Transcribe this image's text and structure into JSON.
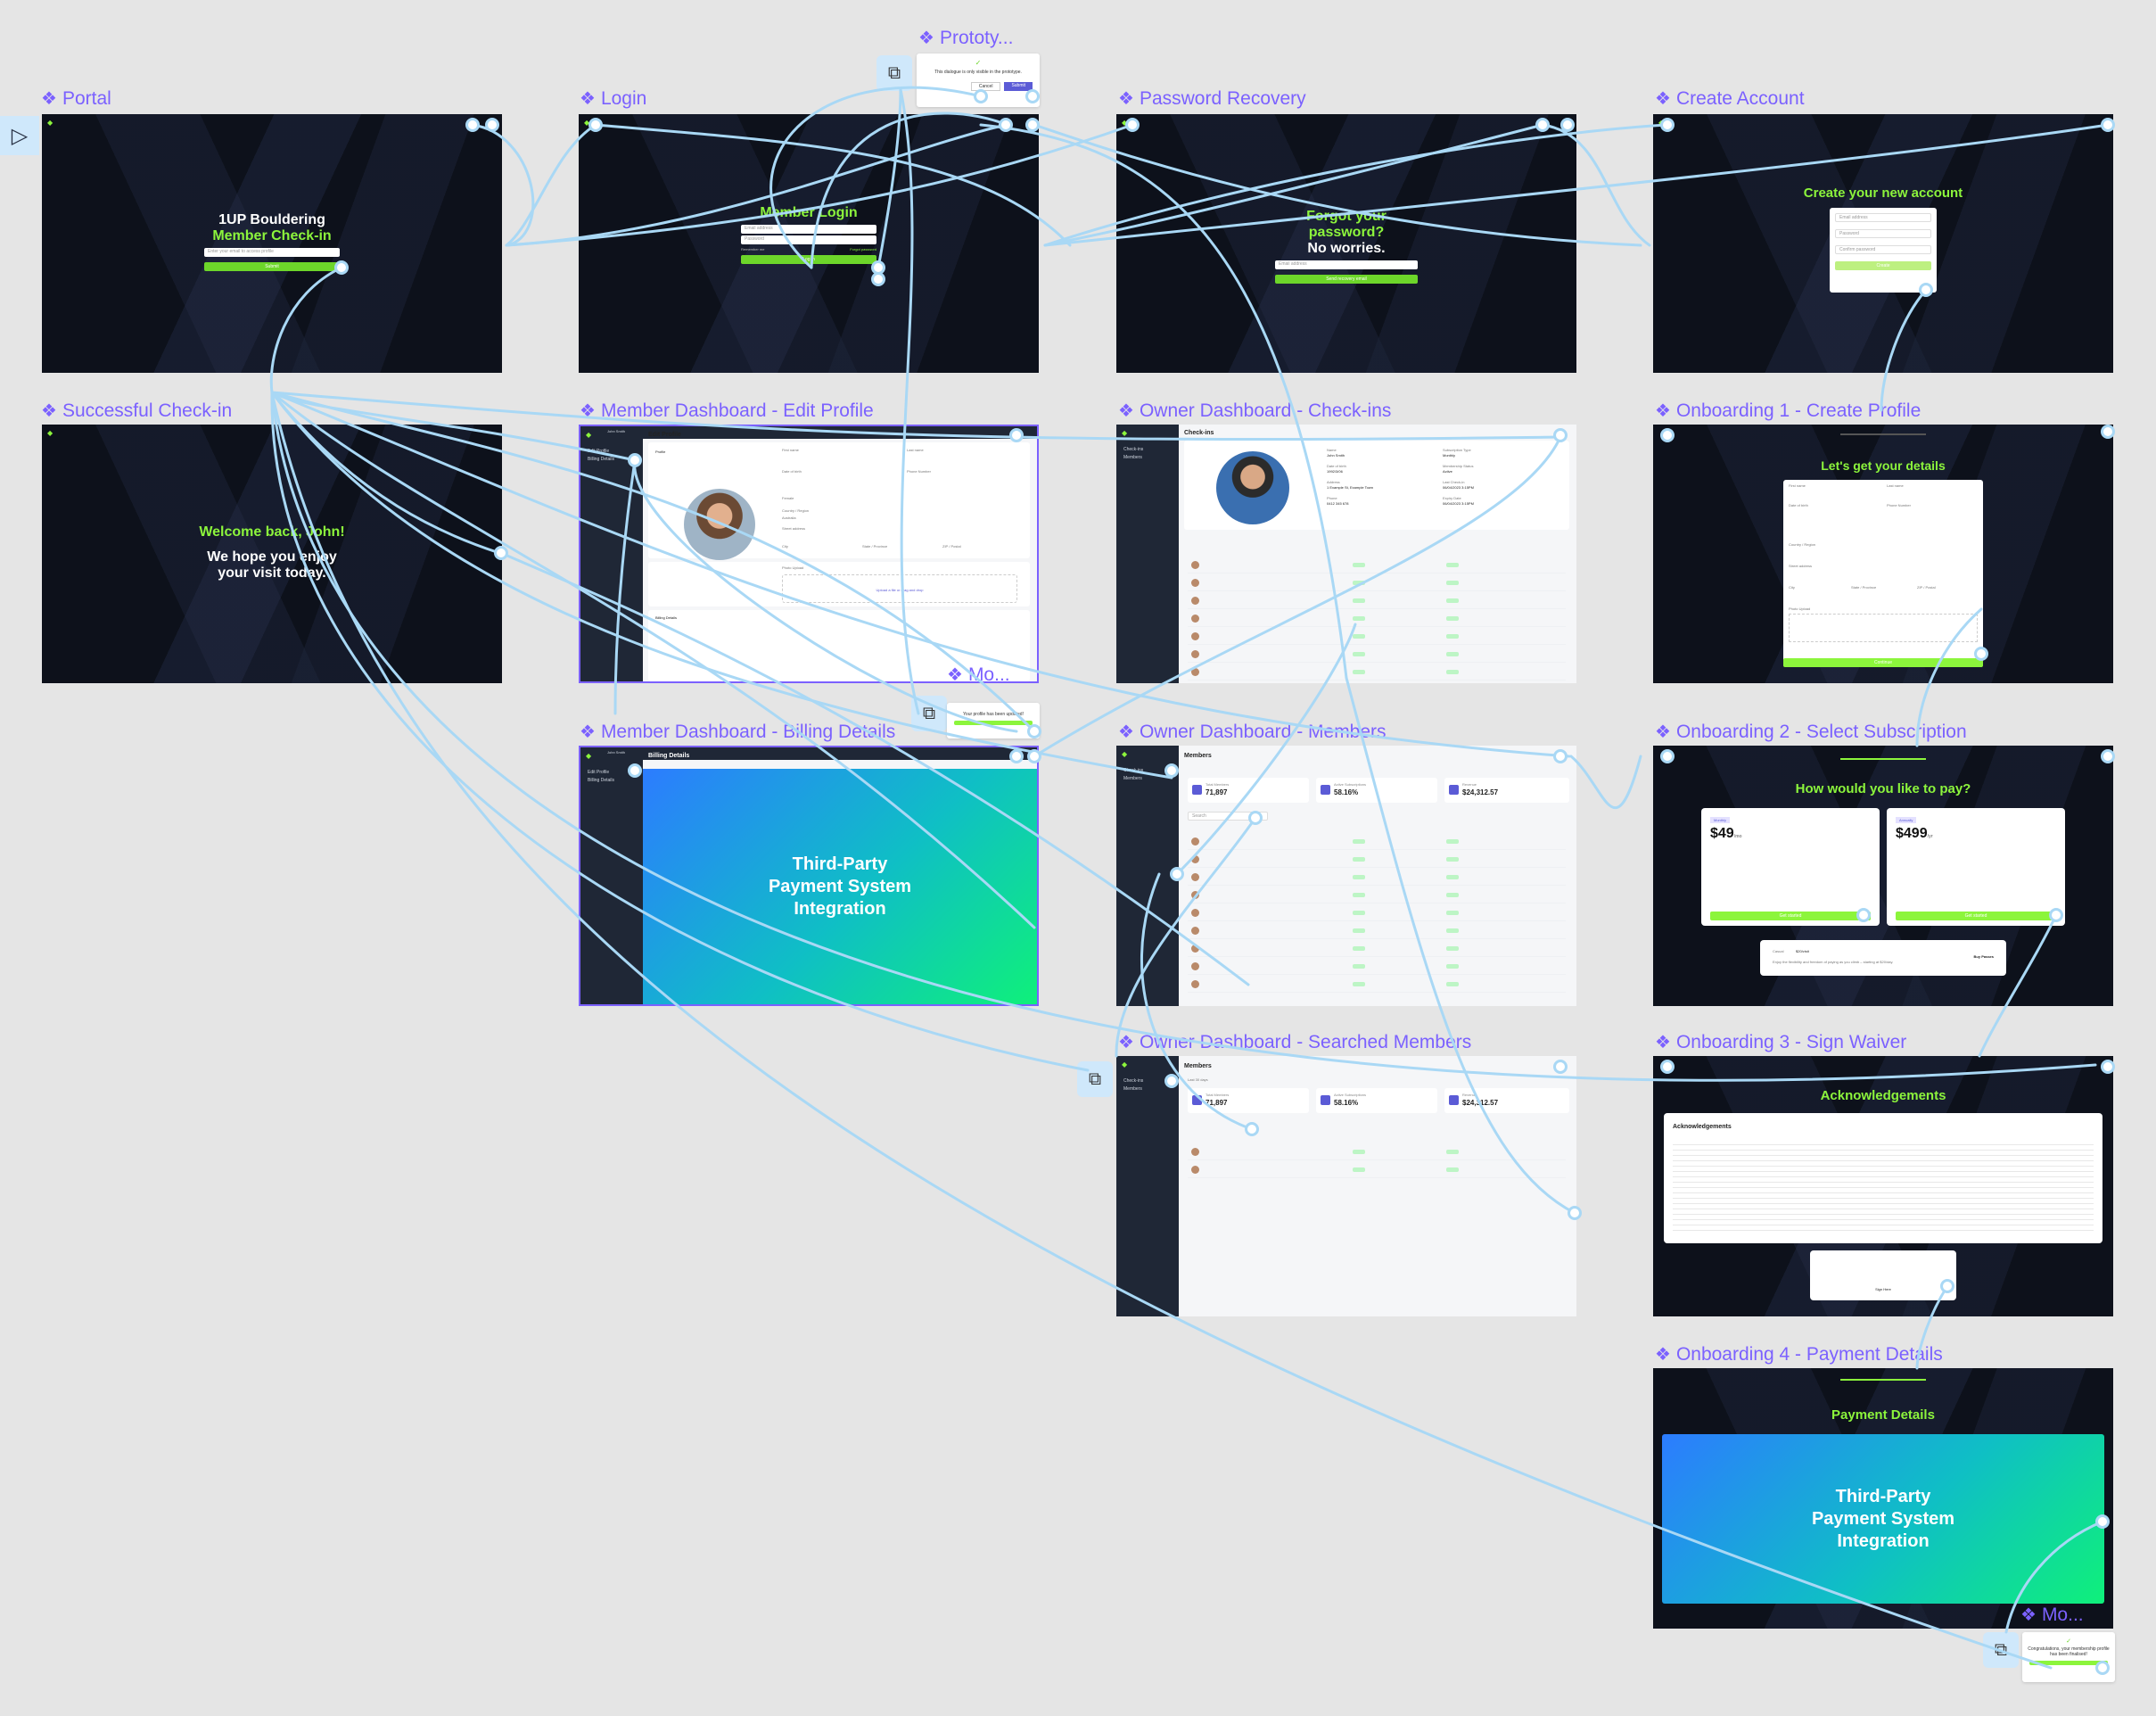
{
  "frames": {
    "portal": {
      "label": "Portal",
      "title": "1UP Bouldering",
      "subtitle": "Member Check-in",
      "input_placeholder": "Enter your email to access profile",
      "button": "Submit"
    },
    "login": {
      "label": "Login",
      "title": "Member Login",
      "email_placeholder": "Email address",
      "password_placeholder": "Password",
      "remember": "Remember me",
      "forgot": "Forgot password",
      "button": "Log in"
    },
    "password_recovery": {
      "label": "Password Recovery",
      "title": "Forgot your password?",
      "subtitle": "No worries.",
      "input_placeholder": "Email address",
      "button": "Send recovery email"
    },
    "create_account": {
      "label": "Create Account",
      "title": "Create your new account",
      "fields": [
        "Email address",
        "Password",
        "Confirm password"
      ],
      "button": "Create"
    },
    "successful_checkin": {
      "label": "Successful Check-in",
      "title": "Welcome back, John!",
      "subtitle": "We hope you enjoy your visit today."
    },
    "member_edit_profile": {
      "label": "Member Dashboard - Edit Profile",
      "heading": "Edit Profile",
      "section_profile": "Profile",
      "section_billing": "Billing Details",
      "fields": [
        "First name",
        "Last name",
        "Date of birth",
        "Phone Number",
        "Country / Region",
        "Street address",
        "City",
        "State / Province",
        "ZIP / Postal",
        "Photo Upload"
      ],
      "gender_value": "Female",
      "country_value": "Australia",
      "upload_text": "Upload a file or drag and drop",
      "sidebar_items": [
        "Edit Profile",
        "Billing Details"
      ],
      "user": "John Smith"
    },
    "member_billing": {
      "label": "Member Dashboard - Billing Details",
      "heading": "Billing Details",
      "placeholder_title": "Third-Party Payment System Integration",
      "sidebar_items": [
        "Edit Profile",
        "Billing Details"
      ],
      "user": "John Smith"
    },
    "owner_checkins": {
      "label": "Owner Dashboard - Check-ins",
      "heading": "Check-ins",
      "sidebar_items": [
        "Check-ins",
        "Members"
      ],
      "detail_labels": [
        "Name",
        "Date of birth",
        "Address",
        "Phone",
        "Subscription Type",
        "Membership Status",
        "Last Check-in",
        "Expiry Date"
      ],
      "detail_values": [
        "John Smith",
        "1992/3/06",
        "1 Example St, Example Town",
        "0412 345 678",
        "Monthly",
        "Active",
        "06/04/2023 3:15PM",
        "06/04/2023 3:15PM"
      ]
    },
    "owner_members": {
      "label": "Owner Dashboard - Members",
      "heading": "Members",
      "stats": [
        {
          "label": "Total Members",
          "value": "71,897"
        },
        {
          "label": "Active Subscriptions",
          "value": "58.16%"
        },
        {
          "label": "Revenue",
          "value": "$24,312.57"
        }
      ],
      "search_placeholder": "Search",
      "sidebar_items": [
        "Check-ins",
        "Members"
      ]
    },
    "owner_searched": {
      "label": "Owner Dashboard - Searched Members",
      "heading": "Members",
      "filter": "Last 30 days",
      "stats": [
        {
          "label": "Total Members",
          "value": "71,897"
        },
        {
          "label": "Active Subscriptions",
          "value": "58.16%"
        },
        {
          "label": "Revenue",
          "value": "$24,312.57"
        }
      ],
      "sidebar_items": [
        "Check-ins",
        "Members"
      ]
    },
    "onboarding1": {
      "label": "Onboarding 1 - Create Profile",
      "title": "Let's get your details",
      "fields": [
        "First name",
        "Last name",
        "Date of birth",
        "Phone Number",
        "Country / Region",
        "Street address",
        "City",
        "State / Province",
        "ZIP / Postal",
        "Photo Upload"
      ],
      "button": "Continue"
    },
    "onboarding2": {
      "label": "Onboarding 2 - Select Subscription",
      "title": "How would you like to pay?",
      "plans": [
        {
          "tag": "Monthly",
          "price": "$49",
          "period": "/mo",
          "button": "Get started"
        },
        {
          "tag": "Annually",
          "price": "$499",
          "period": "/yr",
          "button": "Get started"
        }
      ],
      "casual": {
        "tag": "Casual",
        "price": "$20",
        "period": "/visit",
        "text": "Enjoy the flexibility and freedom of paying as you climb – starting at $20/day.",
        "button": "Buy Passes"
      }
    },
    "onboarding3": {
      "label": "Onboarding 3 - Sign Waiver",
      "title": "Acknowledgements",
      "card_title": "Acknowledgements",
      "button": "Sign Here"
    },
    "onboarding4": {
      "label": "Onboarding 4 - Payment Details",
      "title": "Payment Details",
      "placeholder_title": "Third-Party Payment System Integration"
    }
  },
  "overlays": {
    "prototype": {
      "label": "Prototy...",
      "text": "This dialogue is only visible in the prototype.",
      "buttons": [
        "Cancel",
        "Submit"
      ]
    },
    "modal_profile": {
      "label": "Mo...",
      "text": "Your profile has been updated!"
    },
    "modal_final": {
      "label": "Mo...",
      "text": "Congratulations, your membership profile has been finalised!"
    }
  },
  "colors": {
    "canvas": "#e5e5e5",
    "frame_label": "#7b61ff",
    "brand_green": "#8cf53c",
    "button_green": "#6dd62a",
    "dark_bg": "#0d111b",
    "wire": "#a9d8f5",
    "sidebar": "#1f2736",
    "accent": "#5b5bd6"
  },
  "icons": {
    "frame": "component-diamond-icon",
    "play": "play-icon",
    "overlay": "overlay-frame-icon"
  }
}
